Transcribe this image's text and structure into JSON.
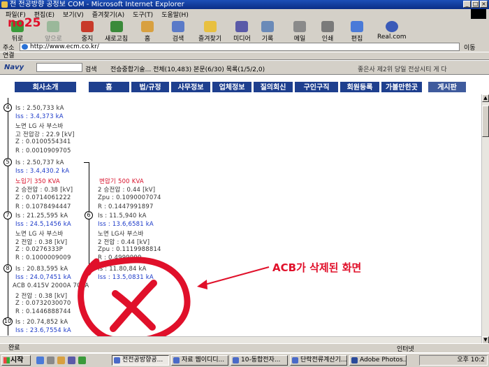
{
  "window": {
    "title": "전 전공방향 공정보 COM - Microsoft Internet Explorer",
    "controls": [
      "_",
      "□",
      "×"
    ]
  },
  "overlay_label": "no25",
  "menu": [
    "파일(F)",
    "편집(E)",
    "보기(V)",
    "즐겨찾기(A)",
    "도구(T)",
    "도움말(H)"
  ],
  "toolbar": {
    "back": "뒤로",
    "forward": "앞으로",
    "stop": "중지",
    "refresh": "새로고침",
    "home": "홈",
    "search": "검색",
    "favorites": "즐겨찾기",
    "media": "미디어",
    "history": "기록",
    "mail": "메일",
    "print": "인쇄",
    "edit": "편집",
    "messenger": "Real.com"
  },
  "address": {
    "label": "주소",
    "url": "http://www.ecm.co.kr/",
    "go": "이동",
    "links": "연결"
  },
  "navy": {
    "brand": "Navy",
    "search_btn": "검색",
    "items": "전승중합기술...   전체(10,483)  본문(6/30)  목록(1/5/2,0)",
    "right": "좋은사 제2위 당일 전상시티 게 다"
  },
  "site_nav": [
    "회사소개",
    "홈",
    "법/규정",
    "사무정보",
    "업체정보",
    "질의회신",
    "구인구직",
    "회원등록",
    "가볼만한곳",
    "게시판"
  ],
  "content": {
    "left_col": [
      {
        "marker": "4",
        "lines": [
          {
            "text": "Is : 2.50,733 kA",
            "style": "normal"
          },
          {
            "text": "Iss : 3.4,373 kA",
            "style": "blue"
          },
          {
            "text": "노면 LG 사 부스바",
            "style": "normal"
          },
          {
            "text": "고 전압강 : 22.9 [kV]",
            "style": "normal"
          },
          {
            "text": "Z : 0.0100554341",
            "style": "normal"
          },
          {
            "text": "R : 0.0010909705",
            "style": "normal"
          }
        ]
      },
      {
        "marker": "5",
        "lines": [
          {
            "text": "Is : 2.50,737 kA",
            "style": "normal"
          },
          {
            "text": "Iss : 3.4,430.2 kA",
            "style": "blue"
          },
          {
            "text": "노입기 350 KVA",
            "style": "red"
          },
          {
            "text": "2 승전압 : 0.38 [kV]",
            "style": "normal"
          },
          {
            "text": "Z : 0.0714061222",
            "style": "normal"
          },
          {
            "text": "R : 0.1078494447",
            "style": "normal"
          }
        ]
      },
      {
        "marker": "7",
        "lines": [
          {
            "text": "Is : 21.25,595 kA",
            "style": "normal"
          },
          {
            "text": "Iss : 24.5,1456 kA",
            "style": "blue"
          },
          {
            "text": "노면 LG 사 부스바",
            "style": "normal"
          },
          {
            "text": "2 전압 : 0.38 [kV]",
            "style": "normal"
          },
          {
            "text": "Z : 0.0276333P",
            "style": "normal"
          },
          {
            "text": "R : 0.1000009009",
            "style": "normal"
          }
        ]
      },
      {
        "marker": "8",
        "lines": [
          {
            "text": "Is : 20.83,595 kA",
            "style": "normal"
          },
          {
            "text": "Iss : 24.0,7451 kA",
            "style": "blue"
          },
          {
            "text": "ACB 0.415V 2000A 70KA",
            "style": "normal"
          },
          {
            "text": "2 전압 : 0.38 [kV]",
            "style": "normal"
          },
          {
            "text": "Z : 0.0732030070",
            "style": "normal"
          },
          {
            "text": "R : 0.1446888744",
            "style": "normal"
          }
        ]
      },
      {
        "marker": "10",
        "lines": [
          {
            "text": "Is : 20.74,852 kA",
            "style": "normal"
          },
          {
            "text": "Iss : 23.6,7554 kA",
            "style": "blue"
          }
        ]
      }
    ],
    "right_col": [
      {
        "text": "변압기 500 KVA",
        "style": "red"
      },
      {
        "text": "2 승전압 : 0.44 [kV]",
        "style": "normal"
      },
      {
        "text": "Zpu : 0.1090007074",
        "style": "normal"
      },
      {
        "text": "R : 0.1447991897",
        "style": "normal"
      },
      {
        "marker": "6",
        "text": "Is : 11.5,940 kA",
        "style": "normal"
      },
      {
        "text": "Iss : 13.6,6581 kA",
        "style": "blue"
      },
      {
        "text": "노면 LG사 부스바",
        "style": "normal"
      },
      {
        "text": "2 전압 : 0.44 [kV]",
        "style": "normal"
      },
      {
        "text": "Zpu : 0.1119988814",
        "style": "normal"
      },
      {
        "text": "R : 0.4999999",
        "style": "normal"
      },
      {
        "text": "Is : 11.80,84 kA",
        "style": "normal"
      },
      {
        "text": "Iss : 13.5,0831 kA",
        "style": "blue"
      }
    ],
    "annotation": "ACB가 삭제된 화면",
    "annotation_color": "#e0102a"
  },
  "status": {
    "left": "완료",
    "right": "인터넷"
  },
  "taskbar": {
    "start": "시작",
    "tasks": [
      "전전공방향공...",
      "자료 웹이디디...",
      "10-동합전자...",
      "단락전류계산기...",
      "Adobe Photos..."
    ],
    "clock": "오후 10:2"
  },
  "colors": {
    "nav_bg": "#1e3f8e",
    "title_bg": "#0a2d86",
    "accent_red": "#e0102a"
  }
}
